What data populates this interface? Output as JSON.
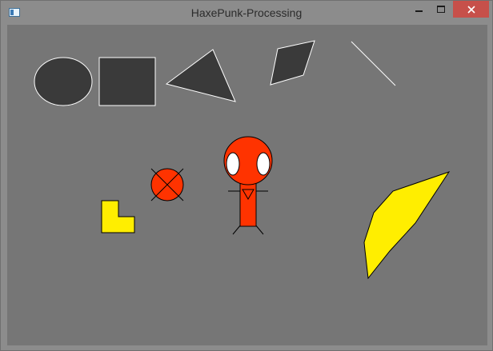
{
  "window": {
    "title": "HaxePunk-Processing",
    "controls": {
      "minimize": "minimize",
      "maximize": "maximize",
      "close": "close"
    }
  },
  "colors": {
    "canvas_bg": "#767676",
    "dark_shape_fill": "#3a3a3a",
    "light_stroke": "#ffffff",
    "red_fill": "#ff3300",
    "yellow_fill": "#ffee00",
    "black_stroke": "#000000",
    "close_button": "#c7504a"
  },
  "icons": [
    "app-window-icon",
    "minimize-icon",
    "maximize-icon",
    "close-icon"
  ]
}
